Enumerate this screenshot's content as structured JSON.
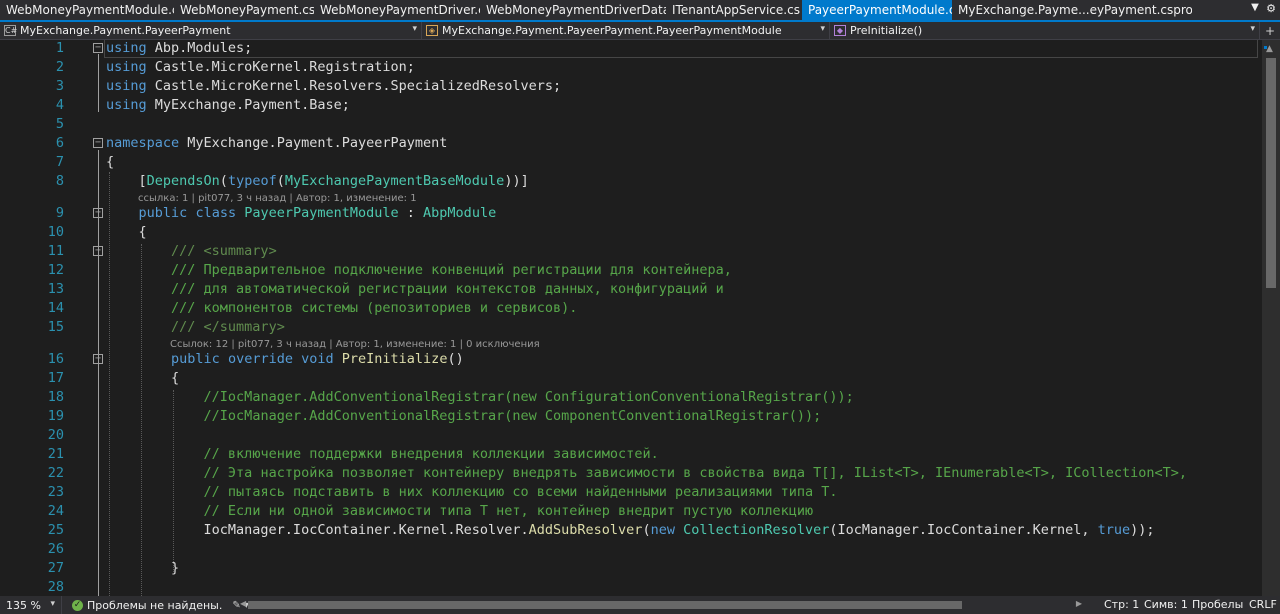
{
  "tabs": [
    {
      "label": "WebMoneyPaymentModule.cs",
      "active": false
    },
    {
      "label": "WebMoneyPayment.cs",
      "active": false
    },
    {
      "label": "WebMoneyPaymentDriver.cs",
      "active": false
    },
    {
      "label": "WebMoneyPaymentDriverData.cs",
      "active": false
    },
    {
      "label": "ITenantAppService.cs",
      "active": false
    },
    {
      "label": "PayeerPaymentModule.cs",
      "active": true
    },
    {
      "label": "MyExchange.Payme...eyPayment.csproj",
      "active": false
    }
  ],
  "navbar": {
    "project": "MyExchange.Payment.PayeerPayment",
    "type": "MyExchange.Payment.PayeerPayment.PayeerPaymentModule",
    "member": "PreInitialize()"
  },
  "code": {
    "lines": [
      {
        "n": "1",
        "html": "<span class=\"kw\">using</span> Abp.Modules;"
      },
      {
        "n": "2",
        "html": "<span class=\"kw\">using</span> Castle.MicroKernel.Registration;"
      },
      {
        "n": "3",
        "html": "<span class=\"kw\">using</span> Castle.MicroKernel.Resolvers.SpecializedResolvers;"
      },
      {
        "n": "4",
        "html": "<span class=\"kw\">using</span> MyExchange.Payment.Base;"
      },
      {
        "n": "5",
        "html": ""
      },
      {
        "n": "6",
        "html": "<span class=\"kw\">namespace</span> MyExchange.Payment.PayeerPayment"
      },
      {
        "n": "7",
        "html": "{"
      },
      {
        "n": "8",
        "html": "    [<span class=\"ty\">DependsOn</span>(<span class=\"kw\">typeof</span>(<span class=\"ty\">MyExchangePaymentBaseModule</span>))]"
      },
      {
        "n": "9",
        "html": "    <span class=\"kw\">public</span> <span class=\"kw\">class</span> <span class=\"ty\">PayeerPaymentModule</span> : <span class=\"ty\">AbpModule</span>"
      },
      {
        "n": "10",
        "html": "    {"
      },
      {
        "n": "11",
        "html": "        <span class=\"xd\">/// &lt;summary&gt;</span>"
      },
      {
        "n": "12",
        "html": "        <span class=\"cm\">/// Предварительное подключение конвенций регистрации для контейнера,</span>"
      },
      {
        "n": "13",
        "html": "        <span class=\"cm\">/// для автоматической регистрации контекстов данных, конфигураций и</span>"
      },
      {
        "n": "14",
        "html": "        <span class=\"cm\">/// компонентов системы (репозиториев и сервисов).</span>"
      },
      {
        "n": "15",
        "html": "        <span class=\"xd\">/// &lt;/summary&gt;</span>"
      },
      {
        "n": "16",
        "html": "        <span class=\"kw\">public</span> <span class=\"kw\">override</span> <span class=\"kw\">void</span> <span class=\"fn\">PreInitialize</span>()"
      },
      {
        "n": "17",
        "html": "        {"
      },
      {
        "n": "18",
        "html": "            <span class=\"cm\">//IocManager.AddConventionalRegistrar(new ConfigurationConventionalRegistrar());</span>"
      },
      {
        "n": "19",
        "html": "            <span class=\"cm\">//IocManager.AddConventionalRegistrar(new ComponentConventionalRegistrar());</span>"
      },
      {
        "n": "20",
        "html": ""
      },
      {
        "n": "21",
        "html": "            <span class=\"cm\">// включение поддержки внедрения коллекции зависимостей.</span>"
      },
      {
        "n": "22",
        "html": "            <span class=\"cm\">// Эта настройка позволяет контейнеру внедрять зависимости в свойства вида T[], IList&lt;T&gt;, IEnumerable&lt;T&gt;, ICollection&lt;T&gt;,</span>"
      },
      {
        "n": "23",
        "html": "            <span class=\"cm\">// пытаясь подставить в них коллекцию со всеми найденными реализациями типа T.</span>"
      },
      {
        "n": "24",
        "html": "            <span class=\"cm\">// Если ни одной зависимости типа T нет, контейнер внедрит пустую коллекцию</span>"
      },
      {
        "n": "25",
        "html": "            IocManager.IocContainer.Kernel.Resolver.<span class=\"fn\">AddSubResolver</span>(<span class=\"kw\">new</span> <span class=\"ty\">CollectionResolver</span>(IocManager.IocContainer.Kernel, <span class=\"kw\">true</span>));"
      },
      {
        "n": "26",
        "html": ""
      },
      {
        "n": "27",
        "html": "        }"
      },
      {
        "n": "28",
        "html": ""
      }
    ],
    "codelens_class": "ссылка: 1 | pit077, 3 ч назад | Автор: 1, изменение: 1",
    "codelens_method": "Ссылок: 12 | pit077, 3 ч назад | Автор: 1, изменение: 1 | 0 исключения"
  },
  "status": {
    "zoom": "135 %",
    "issues": "Проблемы не найдены.",
    "line": "Стр: 1",
    "column": "Симв: 1",
    "whitespace": "Пробелы",
    "eol": "CRLF"
  },
  "colors": {
    "accent": "#007acc",
    "keyword": "#569cd6",
    "type": "#4ec9b0",
    "comment": "#57a64a",
    "line_number": "#2b91af"
  }
}
